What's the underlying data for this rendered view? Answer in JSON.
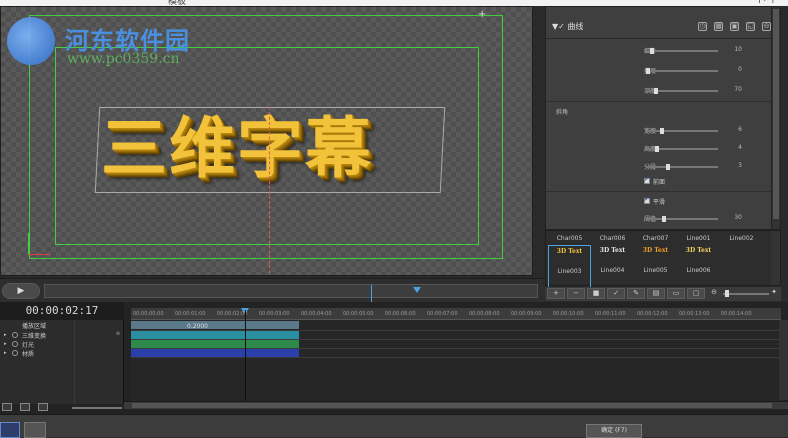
{
  "header": {
    "left_fragment": "模板",
    "right_fragment": "|↑ |"
  },
  "watermark": {
    "site_name": "河东软件园",
    "url": "www.pc0359.cn"
  },
  "canvas": {
    "title_text": "三维字幕",
    "scroll_glyph": "+"
  },
  "transport": {
    "play_label": "▶",
    "progress": 0.68
  },
  "properties": {
    "section_label": "▼✓ 曲线",
    "sliders": [
      {
        "label": "细分",
        "value": "10",
        "fraction": 0.08
      },
      {
        "label": "扩展",
        "value": "0",
        "fraction": 0.0
      },
      {
        "label": "深度",
        "value": "70",
        "fraction": 0.14
      }
    ],
    "bevel_label": "斜角",
    "bevel_sliders": [
      {
        "label": "宽度",
        "value": "6",
        "fraction": 0.2
      },
      {
        "label": "高度",
        "value": "4",
        "fraction": 0.12
      },
      {
        "label": "分段",
        "value": "3",
        "fraction": 0.28
      }
    ],
    "checkbox_front": "前面",
    "checkbox_smooth": "平滑",
    "bottom_slider": {
      "label": "阈值",
      "value": "30",
      "fraction": 0.22
    }
  },
  "gallery": {
    "items": [
      {
        "name": "Char005"
      },
      {
        "name": "Char006"
      },
      {
        "name": "Char007"
      },
      {
        "name": "Line001"
      },
      {
        "name": "Line002"
      },
      {
        "name": "Line003"
      },
      {
        "name": "Line004"
      },
      {
        "name": "Line005"
      },
      {
        "name": "Line006"
      }
    ],
    "swatch_text": "3D Text"
  },
  "timeline": {
    "current_time": "00:00:02:17",
    "ruler_ticks": [
      "00:00:00:00",
      "00:00:01:00",
      "00:00:02:00",
      "00:00:03:00",
      "00:00:04:00",
      "00:00:05:00",
      "00:00:06:00",
      "00:00:07:00",
      "00:00:08:00",
      "00:00:09:00",
      "00:00:10:00",
      "00:00:11:00",
      "00:00:12:00",
      "00:00:13:00",
      "00:00:14:00"
    ],
    "tracks": [
      {
        "name": "播放区域",
        "expand": "",
        "extra": ""
      },
      {
        "name": "三维变换",
        "expand": "▸",
        "extra": "⊘"
      },
      {
        "name": "灯光",
        "expand": "▸",
        "extra": ""
      },
      {
        "name": "材质",
        "expand": "▸",
        "extra": ""
      }
    ],
    "keyframe_value": "0.2000"
  },
  "footer": {
    "apply_label": "确定 (F7)"
  },
  "colors": {
    "accent": "#4aa3df",
    "safe_area": "#3fcf3f",
    "gold": "#f2c23a",
    "clip_teal": "#2a8fa0",
    "clip_blue": "#2a3fa8",
    "clip_green": "#2e8a4a"
  }
}
